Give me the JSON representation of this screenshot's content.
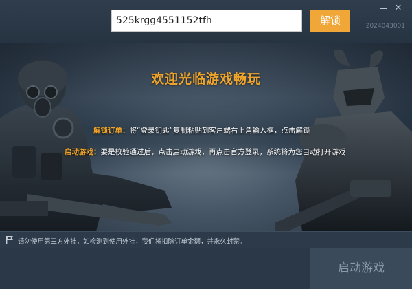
{
  "top": {
    "key_value": "525krgg4551152tfh",
    "unlock_label": "解锁",
    "version": "2024043001",
    "minimize_glyph": "—",
    "close_glyph": "✕"
  },
  "banner": {
    "welcome": "欢迎光临游戏畅玩",
    "line1_tag": "解锁订单：",
    "line1_text": "将“登录钥匙”复制粘贴到客户端右上角输入框，点击解锁",
    "line2_tag": "启动游戏：",
    "line2_text": "要是校验通过后，点击启动游戏，再点击官方登录，系统将为您自动打开游戏"
  },
  "notice": {
    "text": "请勿使用第三方外挂，如检测到使用外挂，我们将扣除订单金额，并永久封禁。",
    "icon": "flag-icon"
  },
  "footer": {
    "start_label": "启动游戏"
  },
  "colors": {
    "accent": "#f1a638",
    "background": "#24313f",
    "start_button": "#3a4a5b"
  }
}
